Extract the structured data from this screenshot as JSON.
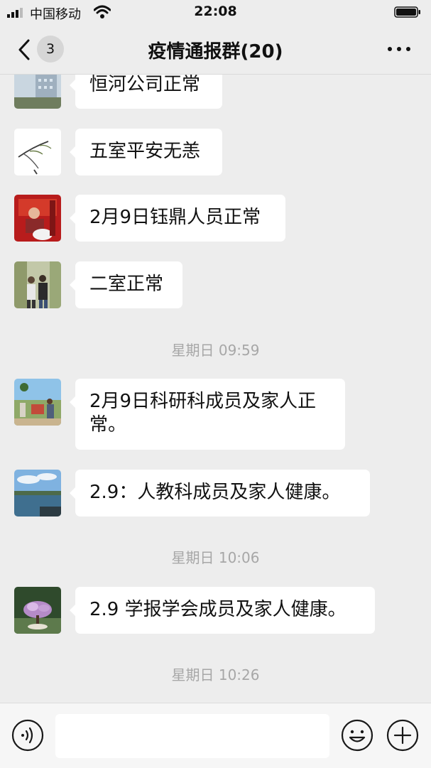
{
  "status_bar": {
    "carrier": "中国移动",
    "time": "22:08",
    "icons": [
      "signal-icon",
      "wifi-icon",
      "battery-icon"
    ]
  },
  "header": {
    "unread_count": "3",
    "title": "疫情通报群(20)",
    "icons": [
      "back-chevron-icon",
      "more-icon"
    ]
  },
  "messages": [
    {
      "text": "恒河公司正常",
      "avatar": "building-photo-avatar"
    },
    {
      "text": "五室平安无恙",
      "avatar": "plant-sketch-avatar"
    },
    {
      "text": "2月9日钰鼎人员正常",
      "avatar": "red-scene-avatar"
    },
    {
      "text": "二室正常",
      "avatar": "couple-photo-avatar"
    },
    {
      "text": "2月9日科研科成员及家人正常。",
      "avatar": "outdoor-group-avatar"
    },
    {
      "text": "2.9：人教科成员及家人健康。",
      "avatar": "seascape-avatar"
    },
    {
      "text": "2.9 学报学会成员及家人健康。",
      "avatar": "flower-tree-avatar"
    }
  ],
  "time_separators": [
    "星期日 09:59",
    "星期日 10:06",
    "星期日 10:26"
  ],
  "input_bar": {
    "placeholder": "",
    "icons": [
      "voice-icon",
      "emoji-icon",
      "plus-icon"
    ]
  },
  "colors": {
    "background": "#ededed",
    "bubble": "#ffffff",
    "timestamp": "#a7a7a7"
  }
}
